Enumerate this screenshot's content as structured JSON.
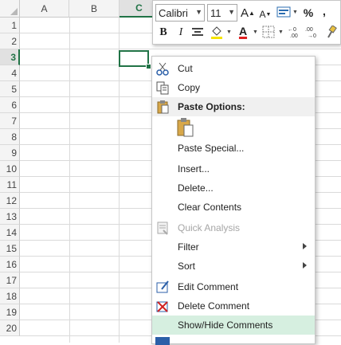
{
  "columns": [
    "A",
    "B",
    "C"
  ],
  "rows": [
    "1",
    "2",
    "3",
    "4",
    "5",
    "6",
    "7",
    "8",
    "9",
    "10",
    "11",
    "12",
    "13",
    "14",
    "15",
    "16",
    "17",
    "18",
    "19",
    "20"
  ],
  "mini_toolbar": {
    "font_name": "Calibri",
    "font_size": "11",
    "grow_font": "A",
    "shrink_font": "A",
    "percent": "%",
    "comma": ",",
    "bold": "B",
    "italic": "I",
    "font_color": "A"
  },
  "menu": {
    "cut": "Cut",
    "copy": "Copy",
    "paste_options": "Paste Options:",
    "paste_special": "Paste Special...",
    "insert": "Insert...",
    "delete": "Delete...",
    "clear_contents": "Clear Contents",
    "quick_analysis": "Quick Analysis",
    "filter": "Filter",
    "sort": "Sort",
    "edit_comment": "Edit Comment",
    "delete_comment": "Delete Comment",
    "show_hide_comments": "Show/Hide Comments"
  },
  "colors": {
    "accent": "#217346",
    "highlight": "#d6efe0",
    "font_color_bar": "#e02020"
  }
}
